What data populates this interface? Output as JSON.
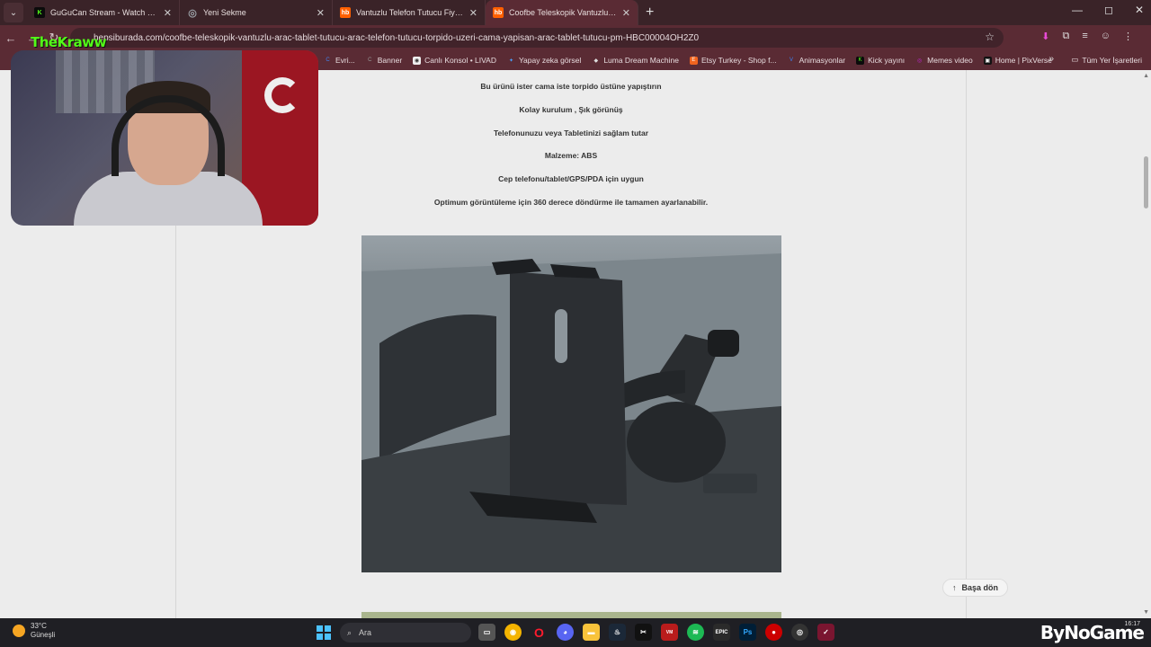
{
  "tabs": [
    {
      "title": "GuGuCan Stream - Watch Live o",
      "favicon": "K",
      "favicon_color": "#53fc18",
      "active": false
    },
    {
      "title": "Yeni Sekme",
      "favicon": "◎",
      "favicon_color": "#9aa0a6",
      "active": false
    },
    {
      "title": "Vantuzlu Telefon Tutucu Fiyatla",
      "favicon": "hb",
      "favicon_color": "#ff6000",
      "active": false
    },
    {
      "title": "Coofbe Teleskopik Vantuzlu Ara",
      "favicon": "hb",
      "favicon_color": "#ff6000",
      "active": true
    }
  ],
  "address_bar": {
    "url": "hepsiburada.com/coofbe-teleskopik-vantuzlu-arac-tablet-tutucu-arac-telefon-tutucu-torpido-uzeri-cama-yapisan-arac-tablet-tutucu-pm-HBC00004OH2Z0"
  },
  "bookmarks": [
    {
      "label": "Evri...",
      "icon": "C",
      "color": "#4285f4"
    },
    {
      "label": "Banner",
      "icon": "C",
      "color": "#333333"
    },
    {
      "label": "Canlı Konsol • LIVAD",
      "icon": "◉",
      "color": "#333333"
    },
    {
      "label": "Yapay zeka görsel",
      "icon": "✦",
      "color": "#4aa3ff"
    },
    {
      "label": "Luma Dream Machine",
      "icon": "◆",
      "color": "#dddddd"
    },
    {
      "label": "Etsy Turkey - Shop f...",
      "icon": "E",
      "color": "#f1641e"
    },
    {
      "label": "Animasyonlar",
      "icon": "V",
      "color": "#3b82f6"
    },
    {
      "label": "Kick yayını",
      "icon": "K",
      "color": "#53fc18"
    },
    {
      "label": "Memes video",
      "icon": "◎",
      "color": "#c026d3"
    },
    {
      "label": "Home | PixVerse",
      "icon": "▣",
      "color": "#111111"
    }
  ],
  "all_bookmarks_label": "Tüm Yer İşaretleri",
  "product_description": [
    "Bu ürünü ister cama iste torpido üstüne yapıştırın",
    "Kolay kurulum , Şık görünüş",
    "Telefonunuzu veya Tabletinizi sağlam tutar",
    "Malzeme: ABS",
    "Cep telefonu/tablet/GPS/PDA için uygun",
    "Optimum görüntüleme için 360 derece döndürme ile tamamen ayarlanabilir."
  ],
  "back_to_top_label": "Başa dön",
  "webcam": {
    "overlay_logo": "TheKraww"
  },
  "taskbar": {
    "weather_temp": "33°C",
    "weather_desc": "Güneşli",
    "search_label": "Ara",
    "clock": "16:17",
    "brand": "ByNoGame"
  },
  "colors": {
    "browser_frame": "#5a2b34",
    "tab_strip": "#3a2328",
    "page_bg": "#ececec",
    "kick_green": "#53fc18"
  }
}
